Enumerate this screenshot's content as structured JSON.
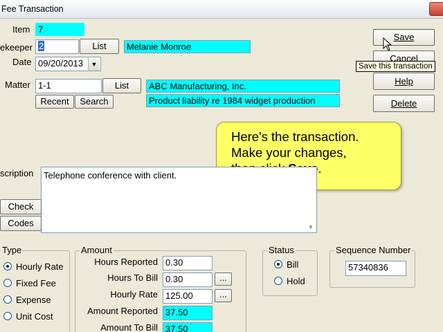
{
  "window": {
    "title": "Fee Transaction"
  },
  "form": {
    "item_label": "Item",
    "item_value": "7",
    "timekeeper_label": "ekeeper",
    "timekeeper_value": "2",
    "timekeeper_list": "List",
    "timekeeper_name": "Melanie Monroe",
    "date_label": "Date",
    "date_value": "09/20/2013",
    "matter_label": "Matter",
    "matter_value": "1-1",
    "matter_list": "List",
    "matter_client": "ABC Manufacturing, Inc.",
    "matter_desc": "Product liability re 1984 widget production",
    "recent": "Recent",
    "search": "Search",
    "description_label": "scription",
    "description_value": "Telephone conference with client.",
    "check": "Check",
    "codes": "Codes"
  },
  "buttons": {
    "save": "Save",
    "cancel": "Cancel",
    "help": "Help",
    "delete": "Delete"
  },
  "tooltip": "Save this transaction",
  "callout": {
    "line1": "Here's the transaction.",
    "line2": "Make your changes,",
    "line3a": "then click ",
    "line3b": "Save",
    "line3c": "."
  },
  "type_group": {
    "label": "Type",
    "options": [
      "Hourly Rate",
      "Fixed Fee",
      "Expense",
      "Unit Cost"
    ],
    "selected": "Hourly Rate"
  },
  "amount_group": {
    "label": "Amount",
    "hours_reported_label": "Hours Reported",
    "hours_reported": "0.30",
    "hours_to_bill_label": "Hours To Bill",
    "hours_to_bill": "0.30",
    "hourly_rate_label": "Hourly Rate",
    "hourly_rate": "125.00",
    "amount_reported_label": "Amount Reported",
    "amount_reported": "37.50",
    "amount_to_bill_label": "Amount To Bill",
    "amount_to_bill": "37.50",
    "ellipsis": "..."
  },
  "status_group": {
    "label": "Status",
    "options": [
      "Bill",
      "Hold"
    ],
    "selected": "Bill"
  },
  "sequence_group": {
    "label": "Sequence Number",
    "value": "57340836"
  },
  "colors": {
    "highlight": "#00ffff",
    "callout": "#ffff66",
    "tooltip": "#ffffe1",
    "window": "#ece9d8"
  }
}
